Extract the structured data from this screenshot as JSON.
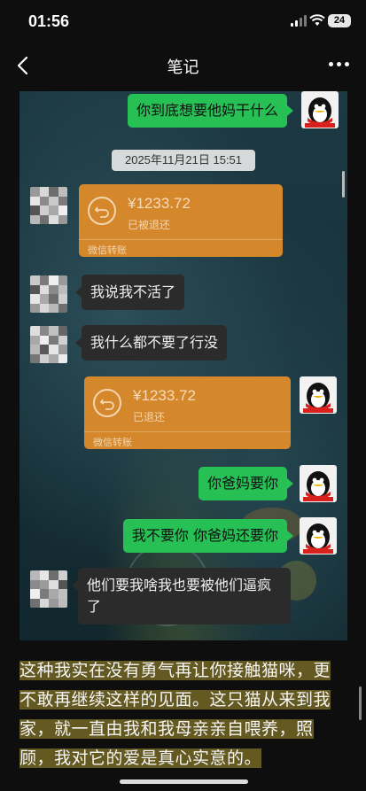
{
  "status_bar": {
    "time": "01:56",
    "battery": "24"
  },
  "nav": {
    "title": "笔记"
  },
  "chat": {
    "msg1": "你到底想要他妈干什么",
    "timestamp": "2025年11月21日 15:51",
    "transfer1": {
      "amount": "¥1233.72",
      "status": "已被退还",
      "footer": "微信转账"
    },
    "msg2": "我说我不活了",
    "msg3": "我什么都不要了行没",
    "transfer2": {
      "amount": "¥1233.72",
      "status": "已退还",
      "footer": "微信转账"
    },
    "msg4": "你爸妈要你",
    "msg5": "我不要你 你爸妈还要你",
    "msg6_line1": "他们要我啥我也要被他们逼疯",
    "msg6_line2": "了"
  },
  "body_text": {
    "line1": "这种我实在没有勇气再让你接触猫咪，更",
    "line2": "不敢再继续这样的见面。这只猫从来到我",
    "line3": "家，就一直由我和我母亲亲自喂养，照",
    "line4": "顾，我对它的爱是真心实意的。"
  },
  "icons": [
    "signal-icon",
    "wifi-icon",
    "battery-icon",
    "back-arrow-icon",
    "more-icon",
    "return-icon",
    "qq-penguin-avatar",
    "pixelated-avatar"
  ]
}
